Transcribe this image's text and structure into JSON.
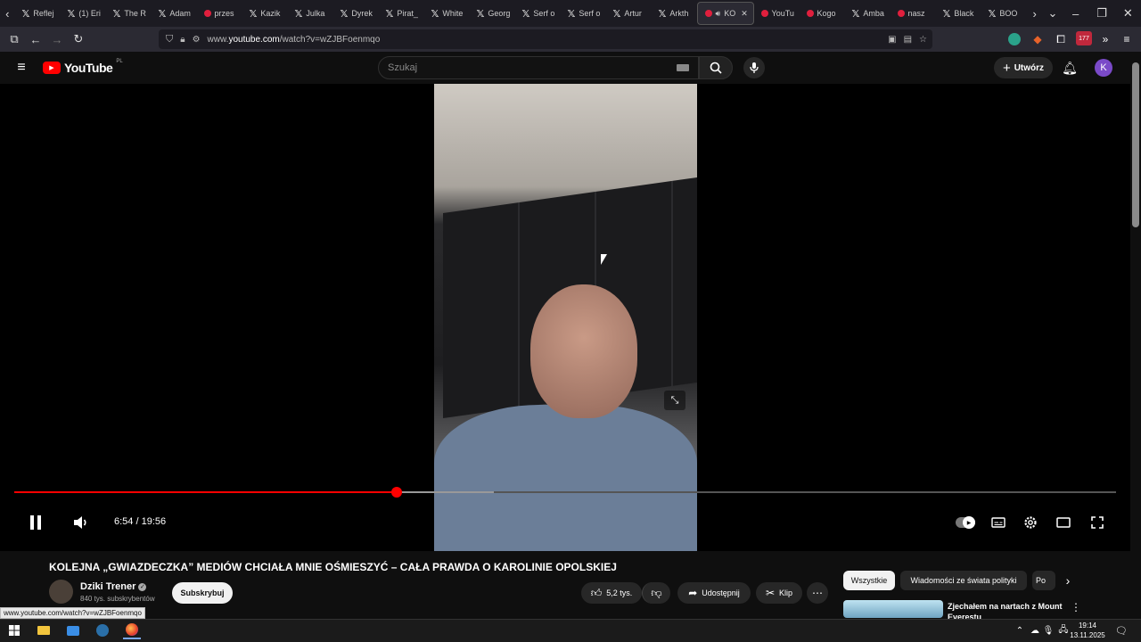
{
  "browser": {
    "tabs": [
      {
        "label": "Reflej",
        "icon": "x-icon"
      },
      {
        "label": "(1) Eri",
        "icon": "x-icon"
      },
      {
        "label": "The R",
        "icon": "x-icon"
      },
      {
        "label": "Adam",
        "icon": "x-icon"
      },
      {
        "label": "przes",
        "icon": "youtube-icon"
      },
      {
        "label": "Kazik",
        "icon": "x-icon"
      },
      {
        "label": "Julka",
        "icon": "x-icon"
      },
      {
        "label": "Dyrek",
        "icon": "x-icon"
      },
      {
        "label": "Pirat_",
        "icon": "x-icon"
      },
      {
        "label": "White",
        "icon": "x-icon"
      },
      {
        "label": "Georg",
        "icon": "x-icon"
      },
      {
        "label": "Serf o",
        "icon": "x-icon"
      },
      {
        "label": "Serf o",
        "icon": "x-icon"
      },
      {
        "label": "Artur",
        "icon": "x-icon"
      },
      {
        "label": "Arkth",
        "icon": "x-icon"
      },
      {
        "label": "KO",
        "icon": "youtube-icon",
        "active": true
      },
      {
        "label": "YouTu",
        "icon": "youtube-icon"
      },
      {
        "label": "Kogo",
        "icon": "youtube-icon"
      },
      {
        "label": "Amba",
        "icon": "x-icon"
      },
      {
        "label": "nasz",
        "icon": "youtube-icon"
      },
      {
        "label": "Black",
        "icon": "x-icon"
      },
      {
        "label": "BOO",
        "icon": "x-icon"
      }
    ],
    "url_prefix": "www.",
    "url_domain": "youtube.com",
    "url_rest": "/watch?v=wZJBFoenmqo",
    "extension_badge": "177",
    "status_url": "www.youtube.com/watch?v=wZJBFoenmqo"
  },
  "youtube": {
    "logo_text": "YouTube",
    "region": "PL",
    "search_placeholder": "Szukaj",
    "create_label": "Utwórz",
    "avatar_letter": "K",
    "brand_color": "#ff0000"
  },
  "player": {
    "time_current": "6:54",
    "time_separator": " / ",
    "time_total": "19:56",
    "progress_fraction": 0.347,
    "buffered_fraction": 0.435
  },
  "video": {
    "title": "KOLEJNA „GWIAZDECZKA” MEDIÓW CHCIAŁA MNIE OŚMIESZYĆ – CAŁA PRAWDA O KAROLINIE OPOLSKIEJ",
    "channel_name": "Dziki Trener",
    "subscribers": "840 tys. subskrybentów",
    "subscribe_label": "Subskrybuj",
    "likes": "5,2 tys.",
    "share_label": "Udostępnij",
    "clip_label": "Klip"
  },
  "sidebar": {
    "chips": [
      "Wszystkie",
      "Wiadomości ze świata polityki",
      "Po"
    ],
    "recommendation_title": "Zjechałem na nartach z Mount Everestu"
  },
  "taskbar": {
    "time": "19:14",
    "date": "13.11.2025"
  }
}
